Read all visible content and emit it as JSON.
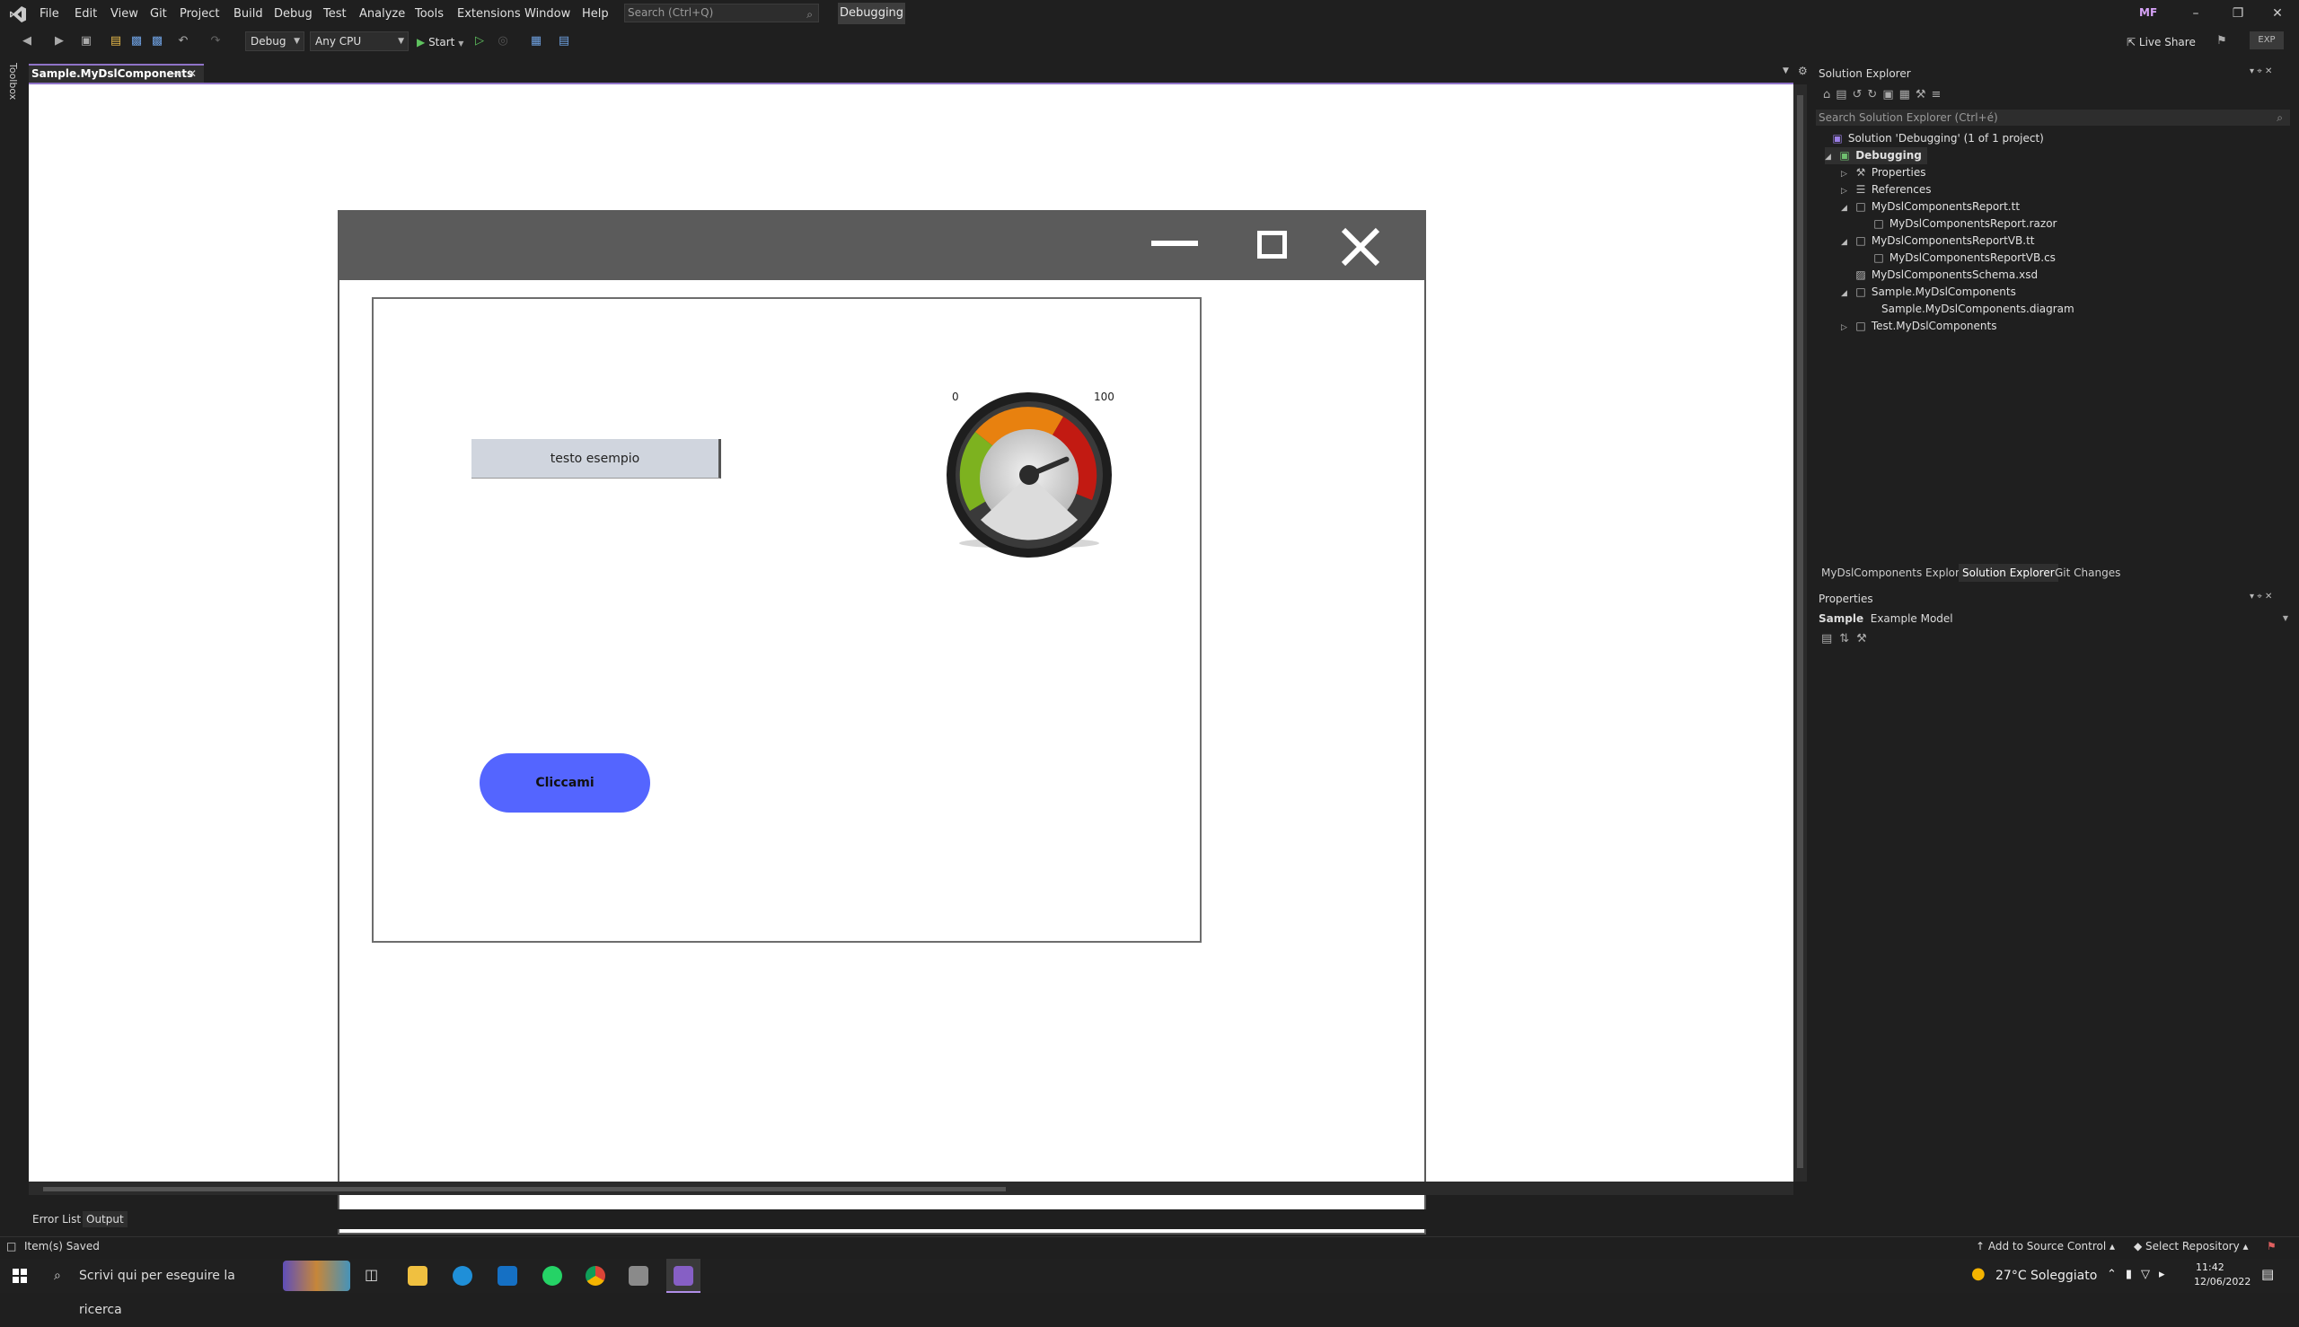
{
  "menubar": {
    "items": [
      "File",
      "Edit",
      "View",
      "Git",
      "Project",
      "Build",
      "Debug",
      "Test",
      "Analyze",
      "Tools",
      "Extensions",
      "Window",
      "Help"
    ],
    "search_placeholder": "Search (Ctrl+Q)",
    "solution_name": "Debugging",
    "user_initials": "MF"
  },
  "toolbar": {
    "config": "Debug",
    "platform": "Any CPU",
    "start_label": "Start",
    "live_share": "Live Share",
    "exp_badge": "EXP"
  },
  "toolbox_label": "Toolbox",
  "document_tab": "Sample.MyDslComponents",
  "designer": {
    "textbox_text": "testo esempio",
    "gauge": {
      "min_label": "0",
      "max_label": "100",
      "value": 78
    },
    "button_text": "Cliccami"
  },
  "bottom_tabs": [
    "Error List",
    "Output"
  ],
  "solution_explorer": {
    "title": "Solution Explorer",
    "search_placeholder": "Search Solution Explorer (Ctrl+é)",
    "solution_label": "Solution 'Debugging' (1 of 1 project)",
    "tree": [
      {
        "label": "Debugging"
      },
      {
        "label": "Properties"
      },
      {
        "label": "References"
      },
      {
        "label": "MyDslComponentsReport.tt"
      },
      {
        "label": "MyDslComponentsReport.razor"
      },
      {
        "label": "MyDslComponentsReportVB.tt"
      },
      {
        "label": "MyDslComponentsReportVB.cs"
      },
      {
        "label": "MyDslComponentsSchema.xsd"
      },
      {
        "label": "Sample.MyDslComponents"
      },
      {
        "label": "Sample.MyDslComponents.diagram"
      },
      {
        "label": "Test.MyDslComponents"
      }
    ],
    "tabs": [
      "MyDslComponents Explorer",
      "Solution Explorer",
      "Git Changes"
    ]
  },
  "properties": {
    "title": "Properties",
    "object_name": "Sample",
    "object_type": "Example Model"
  },
  "statusbar": {
    "message": "Item(s) Saved",
    "source_control": "Add to Source Control",
    "repository": "Select Repository"
  },
  "taskbar": {
    "search_placeholder": "Scrivi qui per eseguire la ricerca",
    "weather": "27°C  Soleggiato",
    "time": "11:42",
    "date": "12/06/2022"
  },
  "colors": {
    "accent": "#8f73c8",
    "button_blue": "#5465ff",
    "mock_titlebar": "#5b5b5b"
  }
}
